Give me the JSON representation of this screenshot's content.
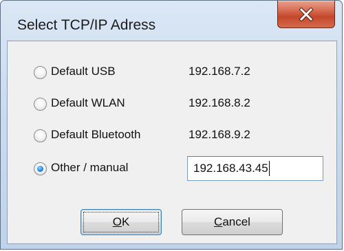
{
  "window": {
    "title": "Select TCP/IP Adress"
  },
  "options": [
    {
      "label": "Default USB",
      "address": "192.168.7.2",
      "checked": false
    },
    {
      "label": "Default WLAN",
      "address": "192.168.8.2",
      "checked": false
    },
    {
      "label": "Default Bluetooth",
      "address": "192.168.9.2",
      "checked": false
    },
    {
      "label": "Other / manual",
      "address": "192.168.43.45",
      "checked": true
    }
  ],
  "buttons": {
    "ok_mnemonic": "O",
    "ok_rest": "K",
    "cancel_mnemonic": "C",
    "cancel_rest": "ancel"
  },
  "colors": {
    "close_button": "#c4472b",
    "radio_selected": "#2a8fe0"
  },
  "icons": {
    "close": "close-icon"
  }
}
